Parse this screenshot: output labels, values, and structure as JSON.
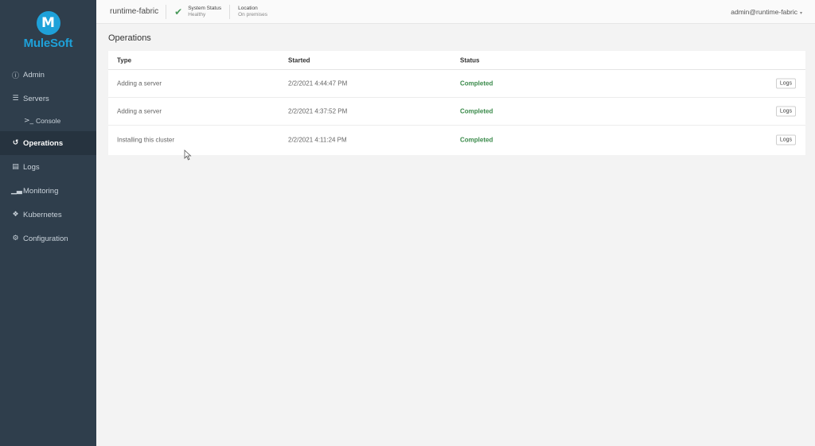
{
  "app": {
    "logo_text": "MuleSoft",
    "logo_letter": "M",
    "brand_color": "#1ea1d9"
  },
  "sidebar": {
    "items": [
      {
        "label": "Admin",
        "icon": "info-icon"
      },
      {
        "label": "Servers",
        "icon": "servers-icon"
      },
      {
        "label": "Console",
        "icon": "terminal-icon"
      },
      {
        "label": "Operations",
        "icon": "history-icon",
        "active": true
      },
      {
        "label": "Logs",
        "icon": "book-icon"
      },
      {
        "label": "Monitoring",
        "icon": "chart-icon"
      },
      {
        "label": "Kubernetes",
        "icon": "cubes-icon"
      },
      {
        "label": "Configuration",
        "icon": "cogs-icon"
      }
    ]
  },
  "topbar": {
    "cluster": "runtime-fabric",
    "system_status_label": "System Status",
    "system_status_value": "Healthy",
    "location_label": "Location",
    "location_value": "On premises",
    "user": "admin@runtime-fabric"
  },
  "main": {
    "title": "Operations",
    "columns": [
      "Type",
      "Started",
      "Status"
    ],
    "rows": [
      {
        "type": "Adding a server",
        "started": "2/2/2021 4:44:47 PM",
        "status": "Completed",
        "action": "Logs"
      },
      {
        "type": "Adding a server",
        "started": "2/2/2021 4:37:52 PM",
        "status": "Completed",
        "action": "Logs"
      },
      {
        "type": "Installing this cluster",
        "started": "2/2/2021 4:11:24 PM",
        "status": "Completed",
        "action": "Logs"
      }
    ]
  },
  "colors": {
    "sidebar_bg": "#2f3e4c",
    "status_completed": "#3a8a4a",
    "healthy_check": "#4a9a5b"
  }
}
